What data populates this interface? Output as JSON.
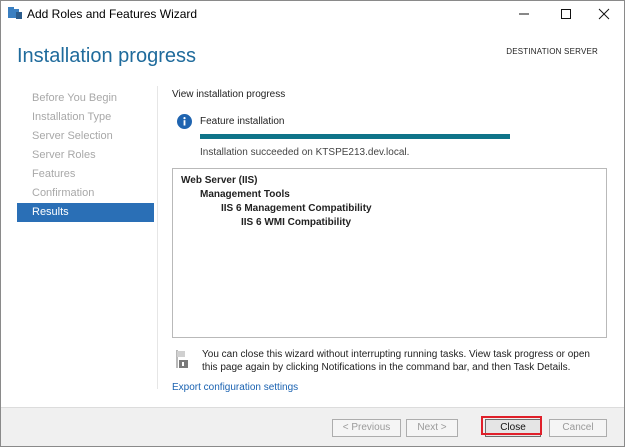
{
  "window": {
    "title": "Add Roles and Features Wizard"
  },
  "header": {
    "title": "Installation progress",
    "destination_server": "DESTINATION SERVER"
  },
  "nav": {
    "items": [
      {
        "label": "Before You Begin",
        "active": false
      },
      {
        "label": "Installation Type",
        "active": false
      },
      {
        "label": "Server Selection",
        "active": false
      },
      {
        "label": "Server Roles",
        "active": false
      },
      {
        "label": "Features",
        "active": false
      },
      {
        "label": "Confirmation",
        "active": false
      },
      {
        "label": "Results",
        "active": true
      }
    ]
  },
  "main": {
    "subtitle": "View installation progress",
    "feature_label": "Feature installation",
    "progress_fraction": 1.0,
    "status": "Installation succeeded on KTSPE213.dev.local.",
    "results": [
      "Web Server (IIS)",
      "Management Tools",
      "IIS 6 Management Compatibility",
      "IIS 6 WMI Compatibility"
    ],
    "note": "You can close this wizard without interrupting running tasks. View task progress or open this page again by clicking Notifications in the command bar, and then Task Details.",
    "export_link": "Export configuration settings"
  },
  "footer": {
    "previous": "< Previous",
    "next": "Next >",
    "close": "Close",
    "cancel": "Cancel"
  },
  "colors": {
    "heading": "#1f6b9c",
    "nav_active": "#2a6fb6",
    "progress": "#0f7489",
    "link": "#1a62b1",
    "highlight": "#e0202a"
  },
  "icons": [
    "wizard-app-icon",
    "minimize-icon",
    "maximize-icon",
    "close-icon",
    "info-icon",
    "flag-note-icon"
  ]
}
